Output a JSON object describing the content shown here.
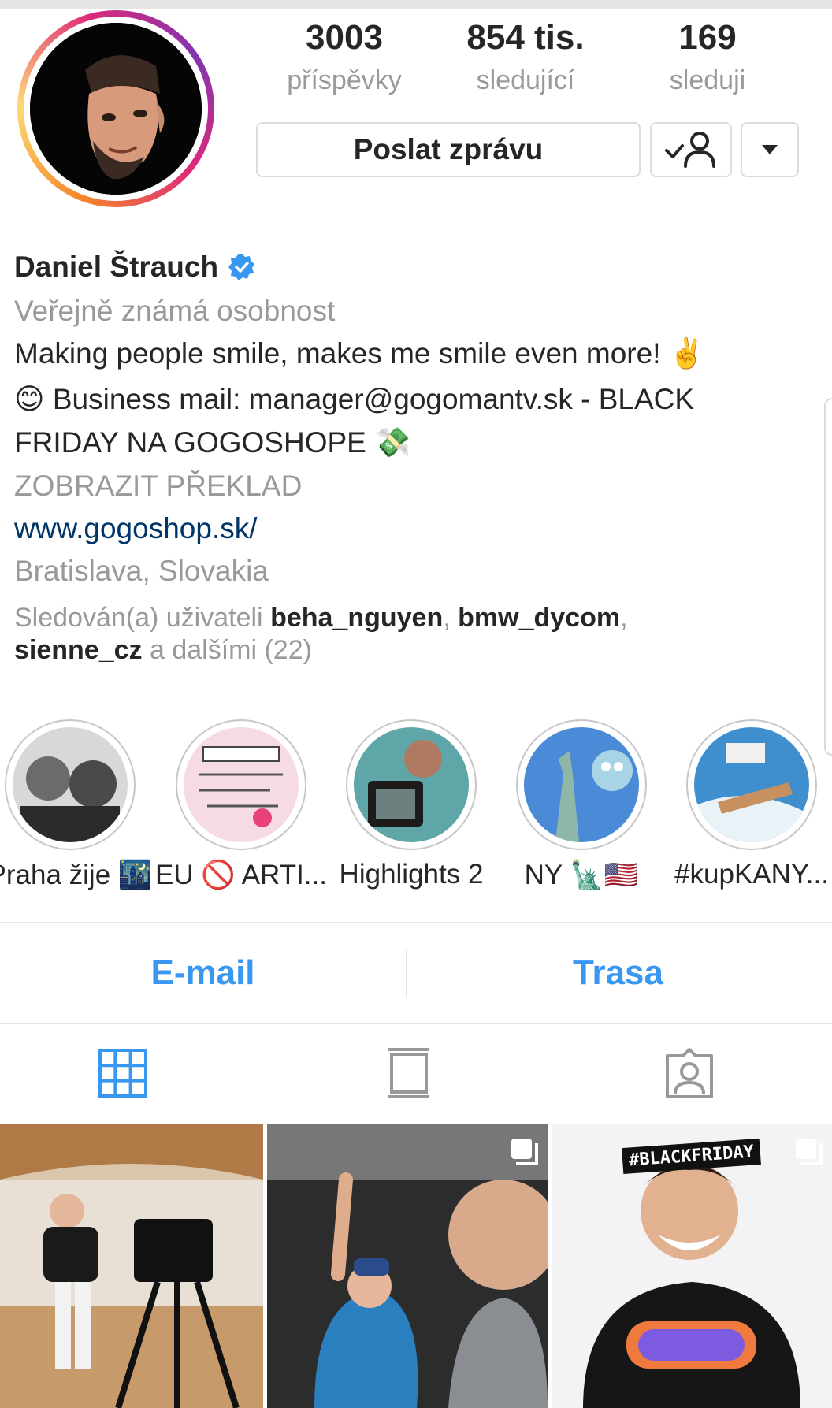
{
  "profile": {
    "name": "Daniel Štrauch",
    "category": "Veřejně známá osobnost",
    "bio_line1": "Making people smile, makes me smile even more! ✌️",
    "bio_line2": "😊 Business mail: manager@gogomantv.sk - BLACK",
    "bio_line3": "FRIDAY NA GOGOSHOPE 💸",
    "translate_label": "ZOBRAZIT PŘEKLAD",
    "website": "www.gogoshop.sk/",
    "location": "Bratislava, Slovakia"
  },
  "stats": [
    {
      "value": "3003",
      "label": "příspěvky"
    },
    {
      "value": "854 tis.",
      "label": "sledující"
    },
    {
      "value": "169",
      "label": "sleduji"
    }
  ],
  "actions": {
    "message_label": "Poslat zprávu",
    "following_icon": "person-check-icon",
    "more_icon": "caret-down-icon"
  },
  "followed_by": {
    "prefix": "Sledován(a) uživateli",
    "user1": "beha_nguyen",
    "sep1": ",",
    "user2": "bmw_dycom",
    "sep2": ",",
    "user3": "sienne_cz",
    "suffix": "a dalšími (22)"
  },
  "highlights": [
    {
      "label": "Praha žije 🌃"
    },
    {
      "label": "EU 🚫 ARTI..."
    },
    {
      "label": "Highlights 2"
    },
    {
      "label": "NY 🗽🇺🇸"
    },
    {
      "label": "#kupKANY..."
    }
  ],
  "contact": {
    "email_label": "E-mail",
    "directions_label": "Trasa"
  },
  "tabs": {
    "grid_icon": "grid-icon",
    "feed_icon": "feed-icon",
    "tagged_icon": "tagged-icon"
  },
  "posts": [
    {
      "overlay": ""
    },
    {
      "overlay": ""
    },
    {
      "overlay": "#BLACKFRIDAY"
    }
  ],
  "colors": {
    "link_blue": "#3897f0",
    "website_blue": "#003569",
    "verified_blue": "#3897f0",
    "secondary_text": "#999999"
  }
}
